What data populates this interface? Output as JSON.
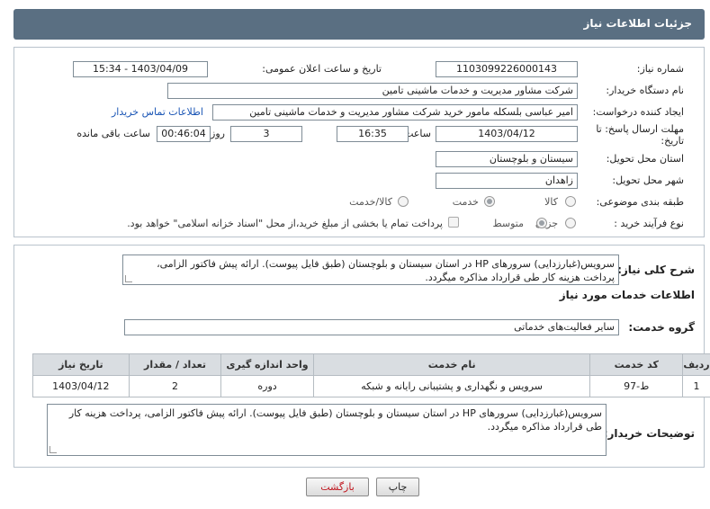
{
  "header": {
    "title": "جزئیات اطلاعات نیاز"
  },
  "form": {
    "need_number_label": "شماره نیاز:",
    "need_number": "1103099226000143",
    "announce_label": "تاریخ و ساعت اعلان عمومی:",
    "announce_value": "1403/04/09 - 15:34",
    "buyer_label": "نام دستگاه خریدار:",
    "buyer_value": "شرکت مشاور مدیریت و خدمات ماشینی تامین",
    "creator_label": "ایجاد کننده درخواست:",
    "creator_value": "امیر عباسی بلسکله مامور خرید شرکت مشاور مدیریت و خدمات ماشینی تامین",
    "contact_link": "اطلاعات تماس خریدار",
    "deadline_label": "مهلت ارسال پاسخ: تا",
    "deadline_label2": "تاریخ:",
    "deadline_date": "1403/04/12",
    "time_label": "ساعت",
    "deadline_time": "16:35",
    "days_value": "3",
    "days_label": "روز و",
    "remaining_time": "00:46:04",
    "remaining_label": "ساعت باقی مانده",
    "province_label": "استان محل تحویل:",
    "province_value": "سیستان و بلوچستان",
    "city_label": "شهر محل تحویل:",
    "city_value": "زاهدان",
    "category_label": "طبقه بندی موضوعی:",
    "category_options": [
      "کالا",
      "خدمت",
      "کالا/خدمت"
    ],
    "process_label": "نوع فرآیند خرید :",
    "process_options": [
      "جزیی",
      "متوسط"
    ],
    "payment_note": "پرداخت تمام یا بخشی از مبلغ خرید،از محل \"اسناد خزانه اسلامی\" خواهد بود."
  },
  "details": {
    "summary_label": "شرح کلی نیاز:",
    "summary_text": "سرویس(غبارزدایی) سرورهای HP در استان سیستان و بلوچستان (طبق فایل پیوست). ارائه پیش فاکتور الزامی، پرداخت هزینه کار طی قرارداد مذاکره میگردد.",
    "services_heading": "اطلاعات خدمات مورد نیاز",
    "service_group_label": "گروه خدمت:",
    "service_group_value": "سایر فعالیت‌های خدماتی",
    "table": {
      "headers": [
        "ردیف",
        "کد خدمت",
        "نام خدمت",
        "واحد اندازه گیری",
        "تعداد / مقدار",
        "تاریخ نیاز"
      ],
      "rows": [
        [
          "1",
          "ط-97",
          "سرویس و نگهداری و پشتیبانی رایانه و شبکه",
          "دوره",
          "2",
          "1403/04/12"
        ]
      ]
    },
    "buyer_notes_label": "توضیحات خریدار:",
    "buyer_notes_text": "سرویس(غبارزدایی) سرورهای HP در استان سیستان و بلوچستان (طبق فایل پیوست). ارائه پیش فاکتور الزامی، پرداخت هزینه کار طی قرارداد مذاکره میگردد."
  },
  "buttons": {
    "print": "چاپ",
    "back": "بازگشت"
  },
  "colors": {
    "header": "#5a6f82",
    "link": "#1a55b5",
    "back_text": "#c0141c"
  }
}
